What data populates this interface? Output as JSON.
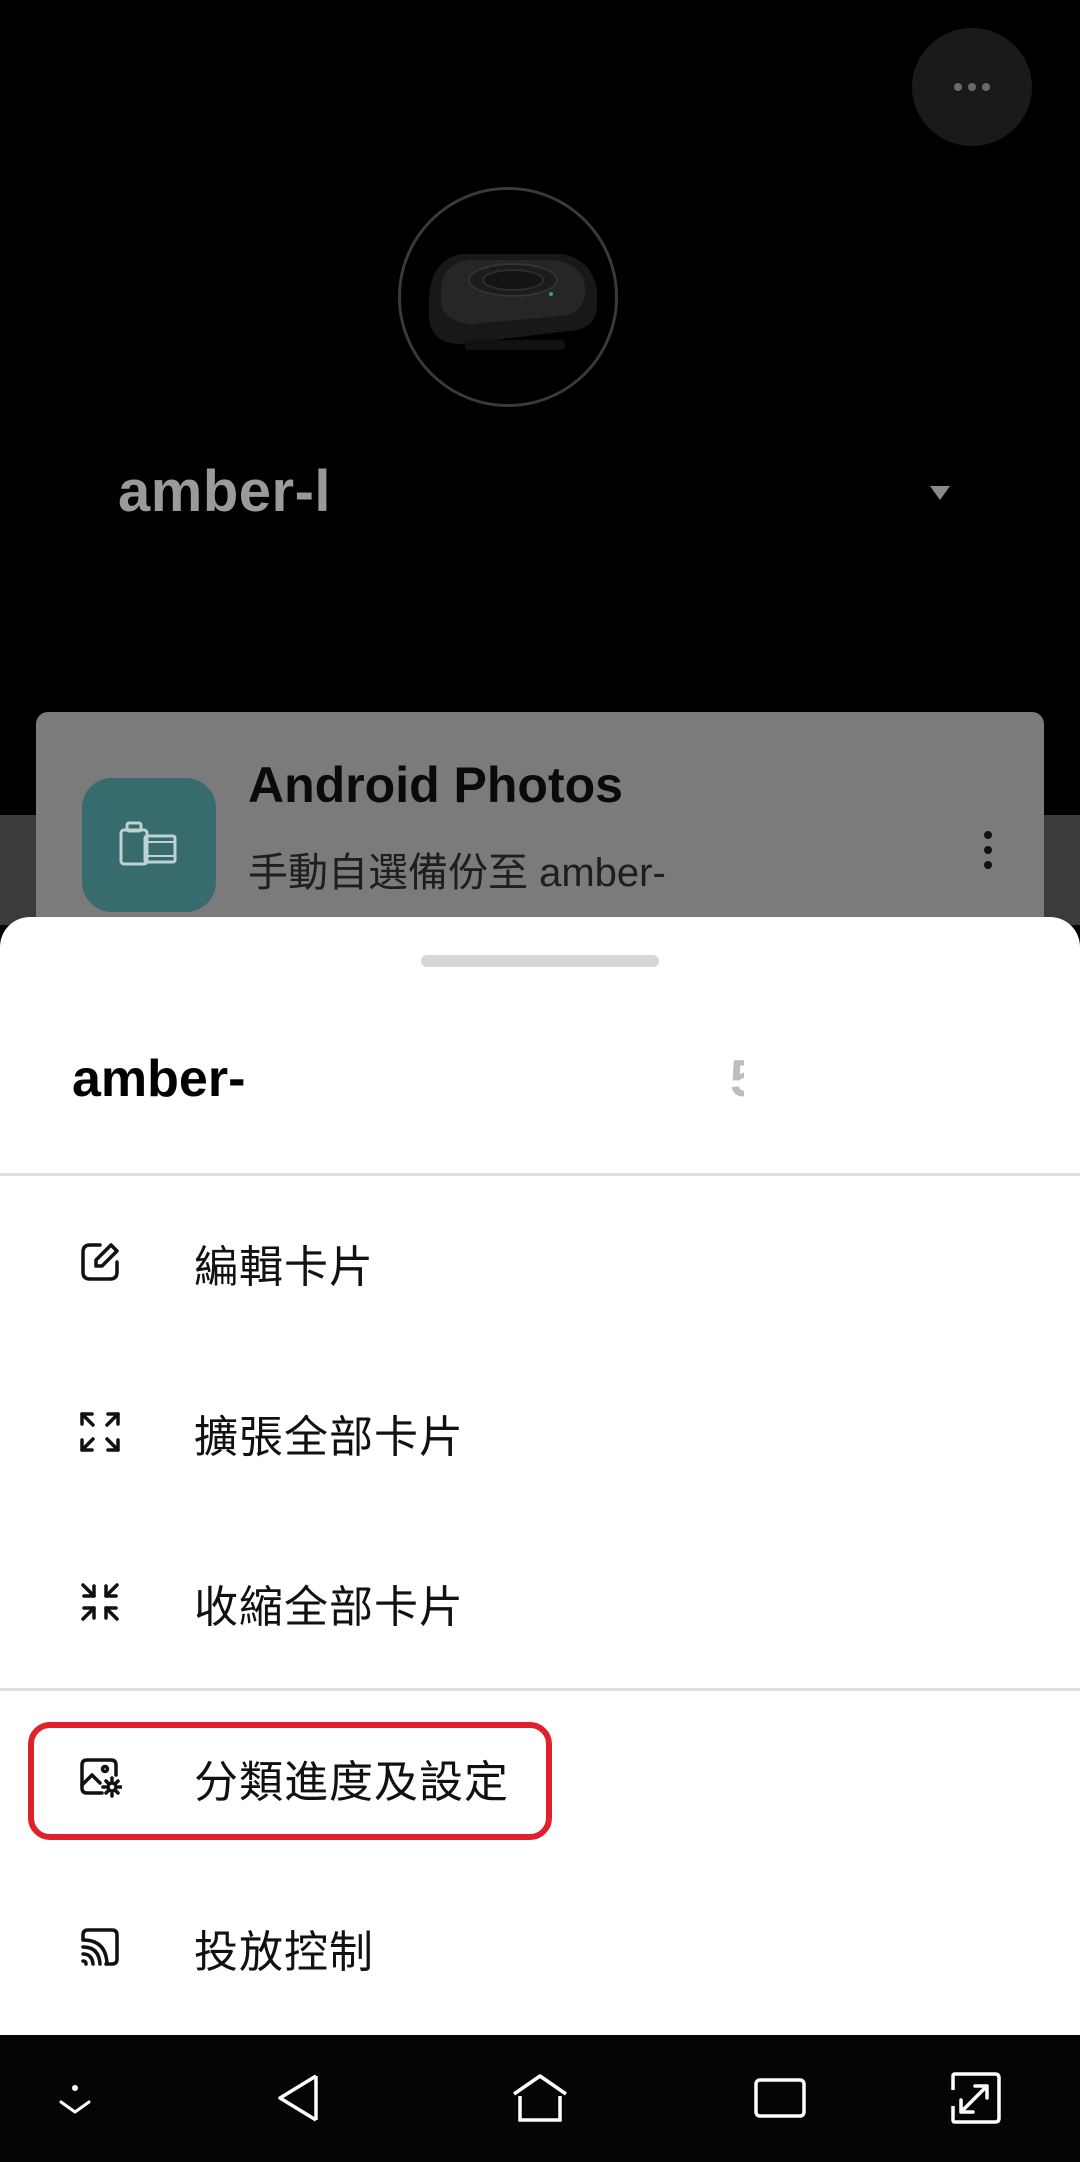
{
  "header": {
    "more_icon": "more-horizontal-icon",
    "device_name": "amber-l",
    "dropdown_icon": "caret-down-icon"
  },
  "card": {
    "title": "Android Photos",
    "subtitle_line1": "手動自選備份至 amber-",
    "subtitle_line2": "",
    "icon": "photo-folder-icon",
    "menu_icon": "more-vertical-icon",
    "accent_color": "#386b6e"
  },
  "sheet": {
    "title": "amber-",
    "title_tail": "5",
    "items": [
      {
        "label": "編輯卡片",
        "icon": "edit-icon"
      },
      {
        "label": "擴張全部卡片",
        "icon": "expand-icon"
      },
      {
        "label": "收縮全部卡片",
        "icon": "collapse-icon"
      },
      {
        "label": "分類進度及設定",
        "icon": "image-settings-icon",
        "highlighted": true
      },
      {
        "label": "投放控制",
        "icon": "cast-icon"
      }
    ],
    "highlight_color": "#e0202a"
  },
  "navbar": {
    "buttons": [
      "hide-nav-icon",
      "back-icon",
      "home-icon",
      "recents-icon",
      "rotate-screen-icon"
    ]
  }
}
